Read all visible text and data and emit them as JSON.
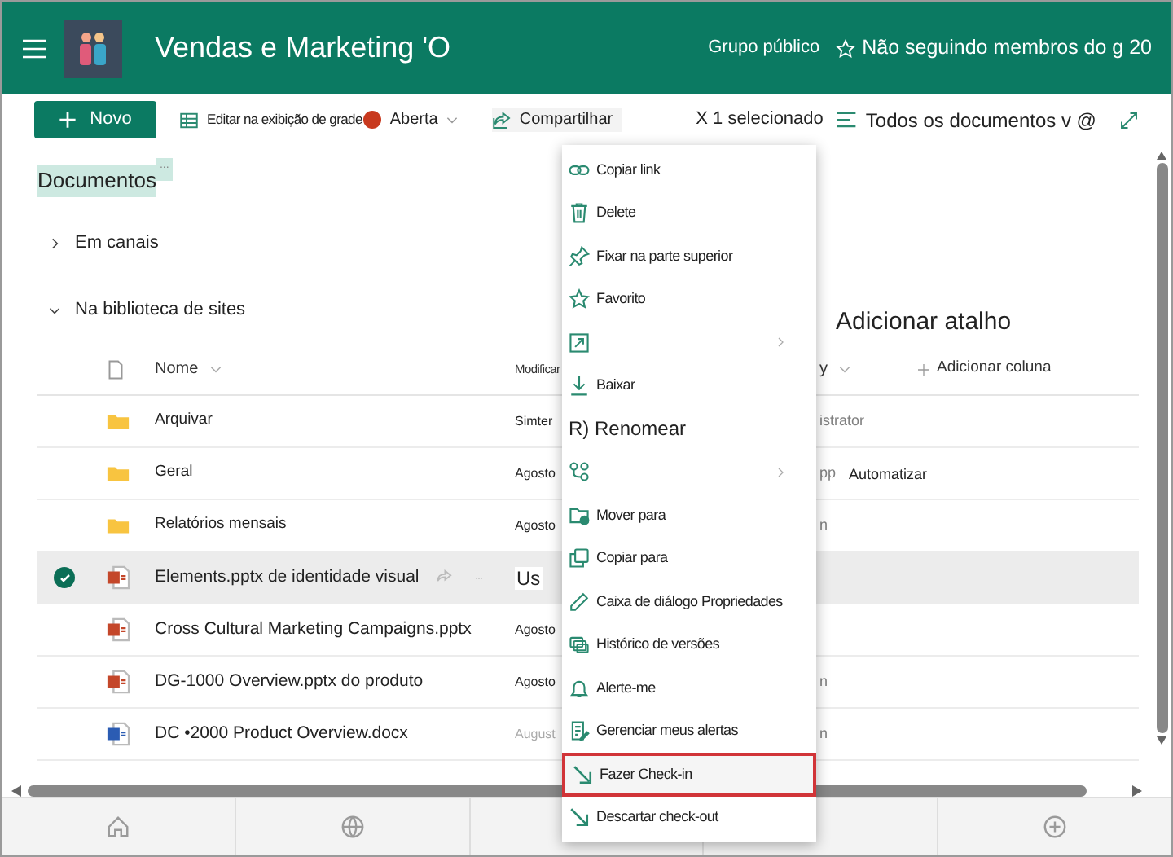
{
  "header": {
    "title": "Vendas e Marketing 'O",
    "group_type": "Grupo público",
    "follow": "Não seguindo membros do g 20"
  },
  "toolbar": {
    "new_button": "Novo",
    "grid_edit": "Editar na exibição de grade",
    "open": "Aberta",
    "share": "Compartilhar",
    "selection": "X 1 selecionado",
    "view": "Todos os documentos v @"
  },
  "library": {
    "title": "Documentos",
    "badge": "...",
    "sections": [
      {
        "label": "Em canais",
        "expanded": false
      },
      {
        "label": "Na biblioteca de sites",
        "expanded": true
      }
    ],
    "add_shortcut": "Adicionar atalho"
  },
  "table": {
    "columns": {
      "name": "Nome",
      "modified": "Modificar",
      "modified_by": "y",
      "add_column": "Adicionar coluna"
    },
    "rows": [
      {
        "kind": "folder",
        "name": "Arquivar",
        "modified": "Simter",
        "modified_by": "istrator",
        "selected": false
      },
      {
        "kind": "folder",
        "name": "Geral",
        "modified": "Agosto",
        "modified_by": "pp",
        "selected": false
      },
      {
        "kind": "folder",
        "name": "Relatórios mensais",
        "modified": "Agosto",
        "modified_by": "n",
        "selected": false
      },
      {
        "kind": "pptx",
        "name": "Elements.pptx de identidade visual",
        "modified": "Us",
        "selected": true
      },
      {
        "kind": "pptx",
        "name": "Cross Cultural Marketing Campaigns.pptx",
        "modified": "Agosto",
        "selected": false
      },
      {
        "kind": "pptx",
        "name": "DG-1000 Overview.pptx do produto",
        "modified": "Agosto",
        "modified_by": "n",
        "selected": false
      },
      {
        "kind": "docx",
        "name": "DC •2000 Product Overview.docx",
        "modified": "August",
        "modified_by": "n",
        "selected": false
      }
    ],
    "floating_label": "Automatizar"
  },
  "context_menu": [
    {
      "kind": "link",
      "label": "Copiar link",
      "selected": false
    },
    {
      "kind": "delete",
      "label": "Delete",
      "selected": false
    },
    {
      "kind": "pin",
      "label": "Fixar na parte superior",
      "selected": false
    },
    {
      "kind": "star",
      "label": "Favorito",
      "selected": false
    },
    {
      "kind": "open",
      "submenu": true,
      "selected": false
    },
    {
      "kind": "download",
      "label": "Baixar",
      "selected": false
    },
    {
      "kind": "text",
      "label": "R) Renomear",
      "selected": false
    },
    {
      "kind": "flow",
      "submenu": true,
      "selected": false
    },
    {
      "kind": "move",
      "label": "Mover para",
      "selected": false
    },
    {
      "kind": "copy",
      "label": "Copiar para",
      "selected": false
    },
    {
      "kind": "edit",
      "label": "Caixa de diálogo Propriedades",
      "selected": false
    },
    {
      "kind": "history",
      "label": "Histórico de versões",
      "selected": false
    },
    {
      "kind": "bell",
      "label": "Alerte-me",
      "selected": false
    },
    {
      "kind": "alerts",
      "label": "Gerenciar meus alertas",
      "selected": false
    },
    {
      "kind": "checkin",
      "label": "Fazer Check-in",
      "selected": true
    },
    {
      "kind": "checkin",
      "label": "Descartar check-out",
      "selected": false
    }
  ]
}
